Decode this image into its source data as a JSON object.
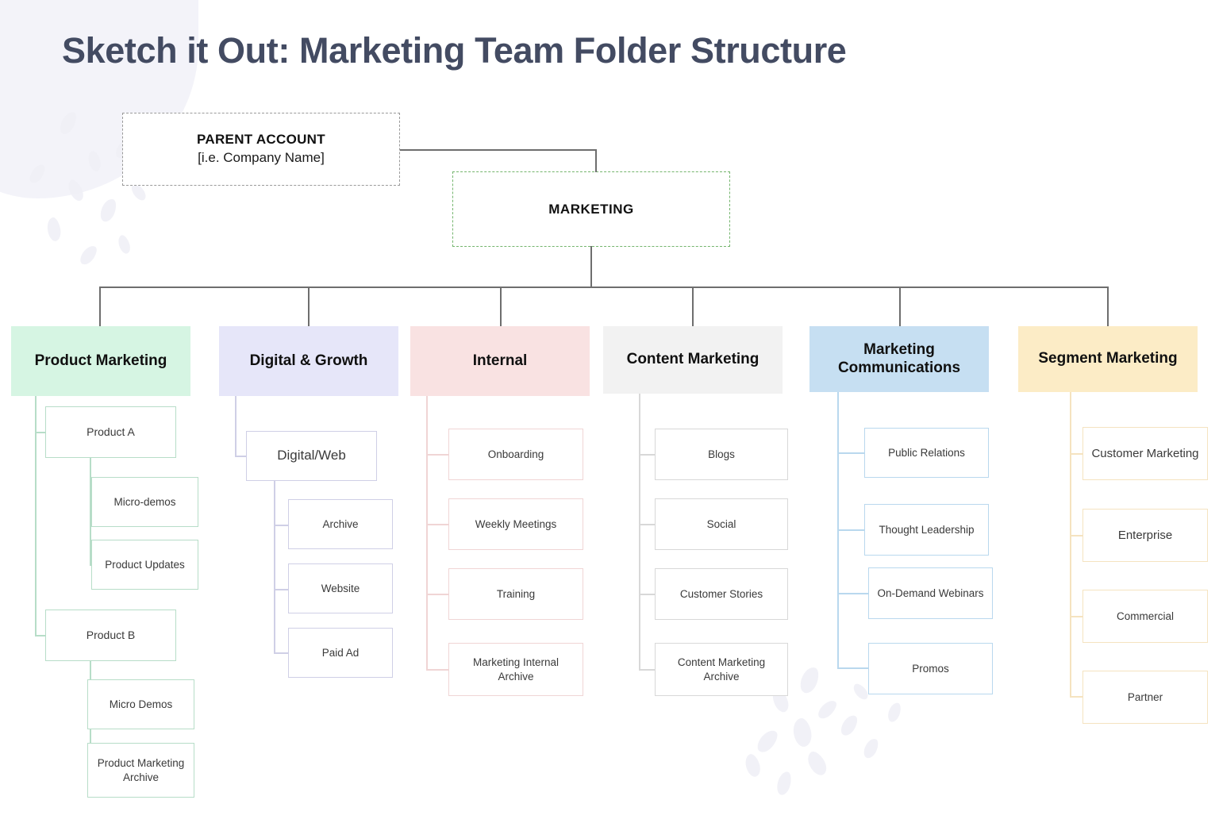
{
  "page": {
    "title": "Sketch it Out: Marketing Team Folder Structure"
  },
  "top": {
    "parent_account": {
      "title": "PARENT ACCOUNT",
      "subtitle": "[i.e. Company Name]",
      "border_color": "#9a9a9a",
      "border_style": "dashed"
    },
    "marketing": {
      "label": "MARKETING",
      "border_color": "#74b56d",
      "border_style": "dashed"
    }
  },
  "chart_data": {
    "type": "diagram",
    "title": "Sketch it Out: Marketing Team Folder Structure",
    "root": "PARENT ACCOUNT",
    "second_level": "MARKETING",
    "columns": [
      {
        "id": "product-marketing",
        "label": "Product Marketing",
        "header_bg": "#d6f5e3",
        "line_color": "#b7ddc8",
        "children": [
          {
            "label": "Product A",
            "children": [
              {
                "label": "Micro-demos"
              },
              {
                "label": "Product Updates"
              }
            ]
          },
          {
            "label": "Product B",
            "children": [
              {
                "label": "Micro Demos"
              },
              {
                "label": "Product Marketing Archive"
              }
            ]
          }
        ]
      },
      {
        "id": "digital-growth",
        "label": "Digital & Growth",
        "header_bg": "#e6e6f9",
        "line_color": "#cfcfe6",
        "children": [
          {
            "label": "Digital/Web",
            "children": [
              {
                "label": "Archive"
              },
              {
                "label": "Website"
              },
              {
                "label": "Paid Ad"
              }
            ]
          }
        ]
      },
      {
        "id": "internal",
        "label": "Internal",
        "header_bg": "#f9e2e2",
        "line_color": "#f0d5d5",
        "children": [
          {
            "label": "Onboarding"
          },
          {
            "label": "Weekly Meetings"
          },
          {
            "label": "Training"
          },
          {
            "label": "Marketing Internal Archive"
          }
        ]
      },
      {
        "id": "content-marketing",
        "label": "Content Marketing",
        "header_bg": "#f2f2f2",
        "line_color": "#d8d8d8",
        "children": [
          {
            "label": "Blogs"
          },
          {
            "label": "Social"
          },
          {
            "label": "Customer Stories"
          },
          {
            "label": "Content Marketing Archive"
          }
        ]
      },
      {
        "id": "marketing-communications",
        "label": "Marketing Communications",
        "header_bg": "#c6dff2",
        "line_color": "#b9d8ee",
        "children": [
          {
            "label": "Public Relations"
          },
          {
            "label": "Thought Leadership"
          },
          {
            "label": "On-Demand Webinars"
          },
          {
            "label": "Promos"
          }
        ]
      },
      {
        "id": "segment-marketing",
        "label": "Segment Marketing",
        "header_bg": "#fcecc6",
        "line_color": "#f5e3c0",
        "children": [
          {
            "label": "Customer Marketing"
          },
          {
            "label": "Enterprise"
          },
          {
            "label": "Commercial"
          },
          {
            "label": "Partner"
          }
        ]
      }
    ]
  },
  "nodes": {
    "c0": {
      "header": "Product Marketing",
      "product_a": "Product A",
      "micro_demos_a": "Micro-demos",
      "product_updates": "Product Updates",
      "product_b": "Product B",
      "micro_demos_b": "Micro Demos",
      "pm_archive": "Product Marketing Archive"
    },
    "c1": {
      "header": "Digital & Growth",
      "digital_web": "Digital/Web",
      "archive": "Archive",
      "website": "Website",
      "paid_ad": "Paid Ad"
    },
    "c2": {
      "header": "Internal",
      "onboarding": "Onboarding",
      "weekly_meetings": "Weekly Meetings",
      "training": "Training",
      "internal_archive": "Marketing Internal Archive"
    },
    "c3": {
      "header": "Content Marketing",
      "blogs": "Blogs",
      "social": "Social",
      "customer_stories": "Customer Stories",
      "cm_archive": "Content Marketing Archive"
    },
    "c4": {
      "header": "Marketing Communications",
      "public_relations": "Public Relations",
      "thought_leadership": "Thought Leadership",
      "on_demand_webinars": "On-Demand Webinars",
      "promos": "Promos"
    },
    "c5": {
      "header": "Segment Marketing",
      "customer_marketing": "Customer Marketing",
      "enterprise": "Enterprise",
      "commercial": "Commercial",
      "partner": "Partner"
    }
  }
}
